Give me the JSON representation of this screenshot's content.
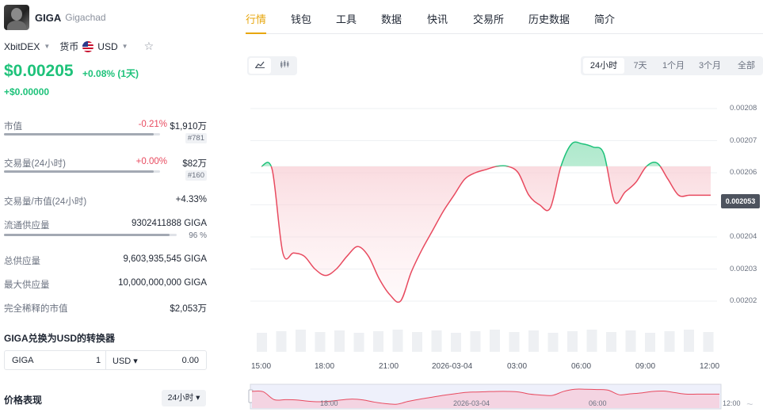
{
  "coin": {
    "symbol": "GIGA",
    "name": "Gigachad"
  },
  "meta": {
    "exchange": "XbitDEX",
    "currency_label": "货币",
    "currency": "USD"
  },
  "price": {
    "value": "$0.00205",
    "change": "+0.08% (1天)",
    "change_abs": "+$0.00000"
  },
  "stats": {
    "market_cap": {
      "label": "市值",
      "pct": "-0.21%",
      "value": "$1,910万",
      "rank": "#781",
      "fill": 0.96
    },
    "volume": {
      "label": "交易量(24小时)",
      "pct": "+0.00%",
      "value": "$82万",
      "rank": "#160",
      "fill": 0.96
    },
    "vol_mcap": {
      "label": "交易量/市值(24小时)",
      "value": "+4.33%"
    },
    "circulating": {
      "label": "流通供应量",
      "value": "9302411888 GIGA",
      "pct": "96 %",
      "fill": 0.96
    },
    "total": {
      "label": "总供应量",
      "value": "9,603,935,545 GIGA"
    },
    "max": {
      "label": "最大供应量",
      "value": "10,000,000,000 GIGA"
    },
    "fdv": {
      "label": "完全稀释的市值",
      "value": "$2,053万"
    }
  },
  "converter": {
    "title": "GIGA兑换为USD的转换器",
    "from_sym": "GIGA",
    "from_val": "1",
    "to_sym": "USD ▾",
    "to_val": "0.00"
  },
  "performance": {
    "title": "价格表现",
    "period": "24小时 ▾"
  },
  "tabs": [
    "行情",
    "钱包",
    "工具",
    "数据",
    "快讯",
    "交易所",
    "历史数据",
    "简介"
  ],
  "chart_controls": {
    "line_icon": "line-chart-icon",
    "candle_icon": "candlestick-icon"
  },
  "ranges": [
    "24小时",
    "7天",
    "1个月",
    "3个月",
    "全部"
  ],
  "colors": {
    "up": "#1ec27a",
    "down": "#e84a5f",
    "accent": "#e7a60d"
  },
  "chart_data": {
    "type": "area",
    "x": [
      "14:45",
      "15:30",
      "16:00",
      "16:30",
      "17:00",
      "17:30",
      "18:00",
      "18:30",
      "19:00",
      "19:30",
      "20:00",
      "20:30",
      "21:00",
      "21:30",
      "22:00",
      "22:30",
      "23:00",
      "23:30",
      "00:00",
      "00:30",
      "01:00",
      "01:30",
      "02:00",
      "02:30",
      "03:00",
      "03:30",
      "04:00",
      "04:30",
      "05:00",
      "05:30",
      "06:00",
      "06:30",
      "07:00",
      "07:30",
      "08:00",
      "08:30",
      "09:00",
      "09:30",
      "10:00",
      "10:30",
      "11:00",
      "11:30",
      "12:00"
    ],
    "values": [
      0.002062,
      0.002061,
      0.002035,
      0.002035,
      0.002034,
      0.00203,
      0.002028,
      0.00203,
      0.002034,
      0.002037,
      0.002034,
      0.002027,
      0.002022,
      0.00202,
      0.002029,
      0.002036,
      0.002042,
      0.002048,
      0.002053,
      0.002058,
      0.00206,
      0.002061,
      0.002062,
      0.002062,
      0.00206,
      0.002053,
      0.00205,
      0.002049,
      0.002062,
      0.002069,
      0.002069,
      0.002068,
      0.002066,
      0.002051,
      0.002054,
      0.002057,
      0.002062,
      0.002063,
      0.002058,
      0.002053,
      0.002053,
      0.002053,
      0.002053
    ],
    "baseline": 0.002062,
    "yticks": [
      "0.00208",
      "0.00207",
      "0.00206",
      "0.00205",
      "0.00204",
      "0.00203",
      "0.00202"
    ],
    "ylim": [
      0.00201,
      0.00208
    ],
    "xticks": [
      "15:00",
      "18:00",
      "21:00",
      "2026-03-04",
      "03:00",
      "06:00",
      "09:00",
      "12:00"
    ],
    "navigator_labels": [
      "18:00",
      "2026-03-04",
      "06:00",
      "12:00"
    ],
    "last_price": "0.002053",
    "grid": true
  }
}
